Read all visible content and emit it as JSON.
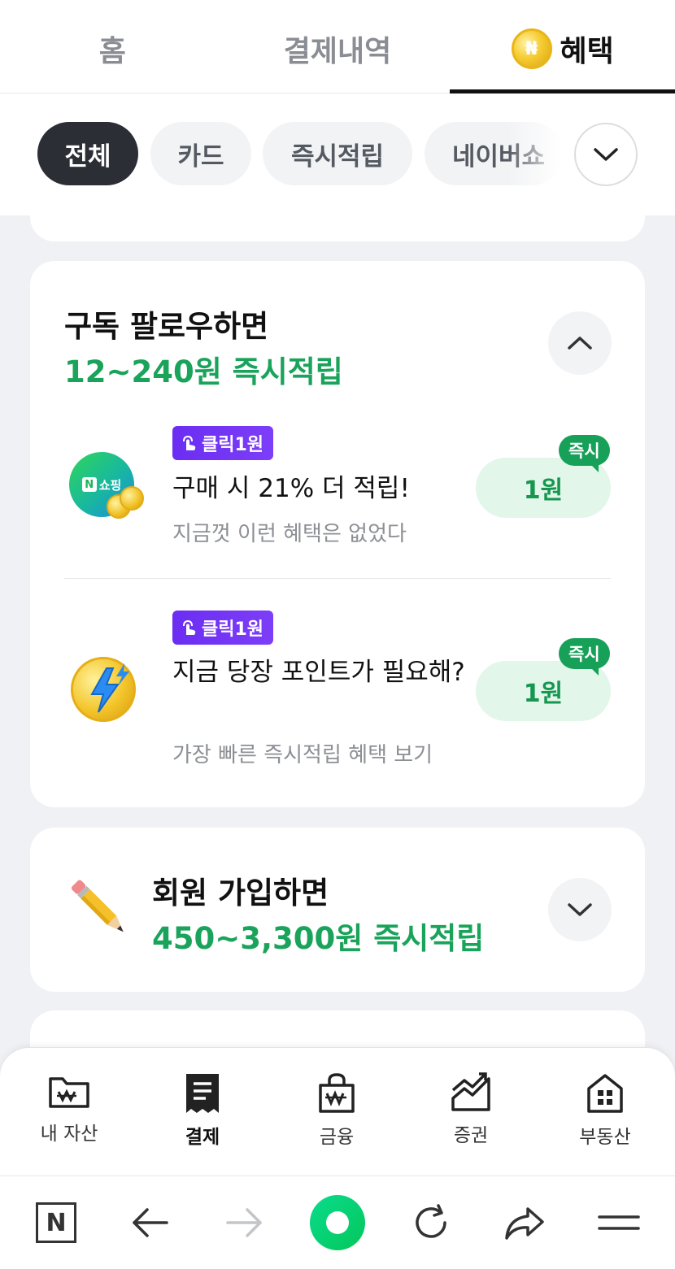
{
  "top_tabs": [
    {
      "label": "홈"
    },
    {
      "label": "결제내역"
    },
    {
      "label": "혜택"
    }
  ],
  "filters": {
    "chips": [
      "전체",
      "카드",
      "즉시적립",
      "네이버쇼"
    ],
    "selected": "전체"
  },
  "subscribe_card": {
    "title": "구독 팔로우하면",
    "subtitle": "12~240원 즉시적립",
    "items": [
      {
        "badge": "클릭1원",
        "title": "구매 시 21% 더 적립!",
        "desc": "지금껏 이런 혜택은 없었다",
        "instant": "즉시",
        "reward": "1원",
        "logo_text": "쇼핑",
        "logo_mark": "N"
      },
      {
        "badge": "클릭1원",
        "title": "지금 당장 포인트가 필요해?",
        "desc": "가장 빠른 즉시적립 혜택 보기",
        "instant": "즉시",
        "reward": "1원"
      }
    ]
  },
  "signup_card": {
    "title": "회원 가입하면",
    "subtitle": "450~3,300원 즉시적립"
  },
  "bottom_nav": [
    {
      "label": "내 자산",
      "icon": "wallet-folder-icon"
    },
    {
      "label": "결제",
      "icon": "receipt-icon",
      "active": true
    },
    {
      "label": "금융",
      "icon": "shopping-bag-icon"
    },
    {
      "label": "증권",
      "icon": "stock-chart-icon"
    },
    {
      "label": "부동산",
      "icon": "building-icon"
    }
  ],
  "browser_bar": {
    "logo": "N"
  },
  "colors": {
    "accent_green": "#1aa35a",
    "badge_purple": "#6b2df2",
    "browser_green": "#03c75a"
  }
}
